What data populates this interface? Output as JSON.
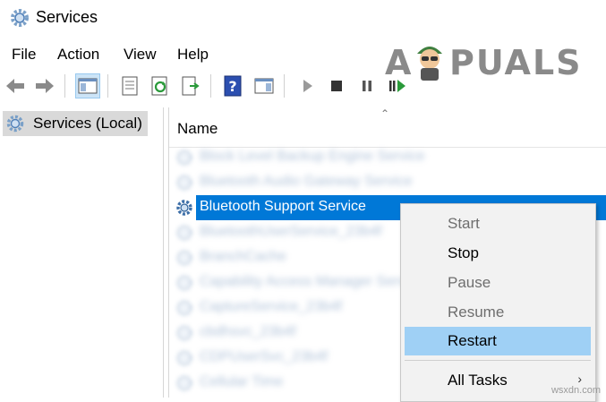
{
  "window": {
    "title": "Services"
  },
  "menu": [
    "File",
    "Action",
    "View",
    "Help"
  ],
  "logo": {
    "text_left": "A",
    "text_right": "PUALS"
  },
  "tree": {
    "root": "Services (Local)"
  },
  "list": {
    "column": "Name",
    "rows": [
      {
        "name": "Block Level Backup Engine Service",
        "blurred": true
      },
      {
        "name": "Bluetooth Audio Gateway Service",
        "blurred": true
      },
      {
        "name": "Bluetooth Support Service",
        "blurred": false,
        "selected": true
      },
      {
        "name": "BluetoothUserService_23b4f",
        "blurred": true
      },
      {
        "name": "BranchCache",
        "blurred": true
      },
      {
        "name": "Capability Access Manager Service",
        "blurred": true
      },
      {
        "name": "CaptureService_23b4f",
        "blurred": true
      },
      {
        "name": "cbdhsvc_23b4f",
        "blurred": true
      },
      {
        "name": "CDPUserSvc_23b4f",
        "blurred": true
      },
      {
        "name": "Cellular Time",
        "blurred": true
      }
    ]
  },
  "context_menu": {
    "items": [
      {
        "label": "Start",
        "state": "disabled"
      },
      {
        "label": "Stop",
        "state": "enabled"
      },
      {
        "label": "Pause",
        "state": "disabled"
      },
      {
        "label": "Resume",
        "state": "disabled"
      },
      {
        "label": "Restart",
        "state": "hover"
      },
      {
        "label": "All Tasks",
        "state": "enabled",
        "submenu": true
      }
    ]
  },
  "watermark": "wsxdn.com",
  "colors": {
    "selection": "#0078d7",
    "hover": "#9fd0f5",
    "gear": "#4f7fb8"
  }
}
